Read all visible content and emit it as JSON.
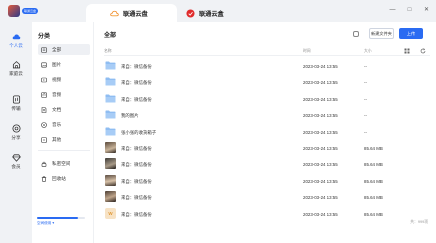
{
  "brand": {
    "badge": "联通云盘"
  },
  "tabs": [
    {
      "label": "联通云盘",
      "active": true
    },
    {
      "label": "联通云盒",
      "active": false
    }
  ],
  "window_controls": [
    "—",
    "□",
    "✕"
  ],
  "nav": [
    {
      "label": "个人云",
      "icon": "cloud-icon",
      "active": true
    },
    {
      "label": "家庭云",
      "icon": "home-icon",
      "active": false
    },
    {
      "label": "传输",
      "icon": "transfer-icon",
      "active": false
    },
    {
      "label": "分享",
      "icon": "share-icon",
      "active": false
    },
    {
      "label": "会员",
      "icon": "diamond-icon",
      "active": false
    }
  ],
  "categories": {
    "title": "分类",
    "items": [
      {
        "label": "全部",
        "icon": "all-files-icon",
        "active": true
      },
      {
        "label": "图片",
        "icon": "image-icon",
        "active": false
      },
      {
        "label": "视频",
        "icon": "video-icon",
        "active": false
      },
      {
        "label": "音频",
        "icon": "audio-icon",
        "active": false
      },
      {
        "label": "文档",
        "icon": "document-icon",
        "active": false
      },
      {
        "label": "音乐",
        "icon": "music-icon",
        "active": false
      },
      {
        "label": "其他",
        "icon": "other-icon",
        "active": false
      }
    ],
    "extras": [
      {
        "label": "私密空间",
        "icon": "lock-icon"
      },
      {
        "label": "回收站",
        "icon": "trash-icon"
      }
    ],
    "storage_label": "空间使用 ▾",
    "storage_fraction": 0.85
  },
  "main": {
    "title": "全部",
    "new_folder_label": "新建文件夹",
    "upload_label": "上传",
    "headers": {
      "name": "名称",
      "modified": "时间",
      "size": "大小"
    },
    "rows": [
      {
        "type": "folder",
        "name": "来自：微信备份",
        "modified": "2023-03-24 13:55",
        "size": "--"
      },
      {
        "type": "folder",
        "name": "来自：微信备份",
        "modified": "2023-03-24 13:55",
        "size": "--"
      },
      {
        "type": "folder",
        "name": "来自：微信备份",
        "modified": "2023-03-24 13:55",
        "size": "--"
      },
      {
        "type": "folder",
        "name": "我的图片",
        "modified": "2023-03-24 13:55",
        "size": "--"
      },
      {
        "type": "folder",
        "name": "张小张的收货箱子",
        "modified": "2023-03-24 13:55",
        "size": "--"
      },
      {
        "type": "photo",
        "name": "来自：微信备份",
        "modified": "2023-03-24 13:55",
        "size": "85.64 MB"
      },
      {
        "type": "photo",
        "name": "来自：微信备份",
        "modified": "2023-03-24 13:55",
        "size": "85.64 MB"
      },
      {
        "type": "photo",
        "name": "来自：微信备份",
        "modified": "2023-03-24 13:55",
        "size": "85.64 MB"
      },
      {
        "type": "photo",
        "name": "来自：微信备份",
        "modified": "2023-03-24 13:55",
        "size": "85.64 MB"
      },
      {
        "type": "doc",
        "name": "来自：微信备份",
        "modified": "2023-03-24 13:55",
        "size": "85.64 MB",
        "thumb_letter": "W"
      }
    ],
    "footer_count": "共：999项"
  }
}
